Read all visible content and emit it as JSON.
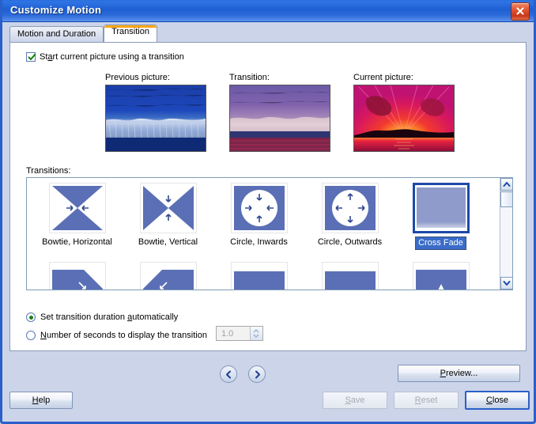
{
  "window": {
    "title": "Customize Motion",
    "close_icon": "close-icon"
  },
  "tabs": [
    {
      "label": "Motion and Duration",
      "active": false
    },
    {
      "label": "Transition",
      "active": true
    }
  ],
  "checkbox": {
    "label_pre": "St",
    "label_acc": "a",
    "label_post": "rt current picture using a transition",
    "checked": true
  },
  "previews": [
    {
      "label": "Previous picture:",
      "kind": "blue-forest"
    },
    {
      "label": "Transition:",
      "kind": "blended"
    },
    {
      "label": "Current picture:",
      "kind": "red-sunset"
    }
  ],
  "transitions": {
    "group_label": "Transitions:",
    "items": [
      {
        "label": "Bowtie, Horizontal",
        "icon": "bowtie-horizontal-icon",
        "selected": false
      },
      {
        "label": "Bowtie, Vertical",
        "icon": "bowtie-vertical-icon",
        "selected": false
      },
      {
        "label": "Circle, Inwards",
        "icon": "circle-inwards-icon",
        "selected": false
      },
      {
        "label": "Circle, Outwards",
        "icon": "circle-outwards-icon",
        "selected": false
      },
      {
        "label": "Cross Fade",
        "icon": "cross-fade-icon",
        "selected": true
      },
      {
        "label": "",
        "icon": "diagonal-down-right-icon",
        "selected": false
      },
      {
        "label": "",
        "icon": "diagonal-down-left-icon",
        "selected": false
      },
      {
        "label": "",
        "icon": "wipe-down-icon",
        "selected": false
      },
      {
        "label": "",
        "icon": "wipe-down-b-icon",
        "selected": false
      },
      {
        "label": "",
        "icon": "inset-up-icon",
        "selected": false
      }
    ],
    "scroll_up_icon": "chevron-up-icon",
    "scroll_down_icon": "chevron-down-icon"
  },
  "duration": {
    "auto": {
      "label_pre": "Set transition duration ",
      "label_acc": "a",
      "label_post": "utomatically",
      "selected": true
    },
    "manual": {
      "label_pre": "",
      "label_acc": "N",
      "label_post": "umber of seconds to display the transition",
      "selected": false
    },
    "spinner_value": "1.0"
  },
  "footer": {
    "prev_icon": "chevron-left-icon",
    "next_icon": "chevron-right-icon",
    "help": {
      "label_acc": "H",
      "label_post": "elp"
    },
    "preview": {
      "label_acc": "P",
      "label_post": "review...",
      "enabled": true
    },
    "save": {
      "label_acc": "S",
      "label_post": "ave",
      "enabled": false
    },
    "reset": {
      "label_acc": "R",
      "label_post": "eset",
      "enabled": false
    },
    "close": {
      "label_acc": "C",
      "label_post": "lose",
      "enabled": true,
      "default": true
    }
  },
  "colors": {
    "titlebar": "#1e5fd2",
    "dialog_bg": "#ccd4ea",
    "accent_blue": "#5a6fb5",
    "selection": "#3a6cc8",
    "tab_active_top": "#ff9c00"
  }
}
